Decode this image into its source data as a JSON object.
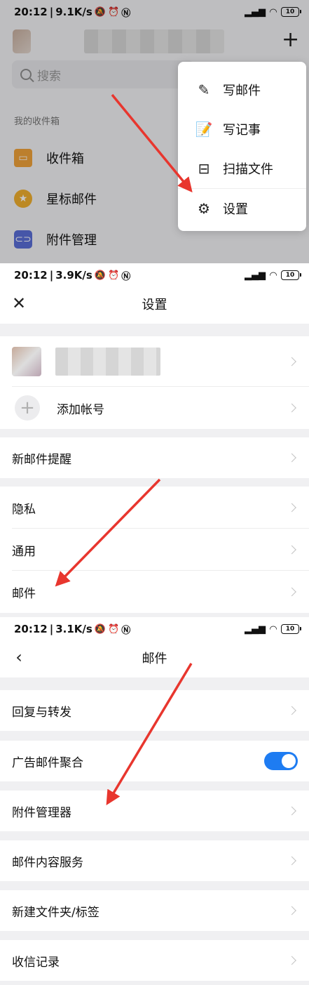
{
  "panel1": {
    "status": {
      "time": "20:12",
      "speed": "9.1K/s",
      "battery": "10"
    },
    "search_placeholder": "搜索",
    "section_label": "我的收件箱",
    "mailboxes": [
      {
        "label": "收件箱",
        "icon": "inbox-icon"
      },
      {
        "label": "星标邮件",
        "icon": "star-icon"
      },
      {
        "label": "附件管理",
        "icon": "attachment-icon"
      }
    ],
    "menu": [
      {
        "label": "写邮件",
        "icon": "compose-icon"
      },
      {
        "label": "写记事",
        "icon": "note-icon"
      },
      {
        "label": "扫描文件",
        "icon": "scan-icon"
      },
      {
        "label": "设置",
        "icon": "gear-icon"
      }
    ]
  },
  "panel2": {
    "status": {
      "time": "20:12",
      "speed": "3.9K/s",
      "battery": "10"
    },
    "title": "设置",
    "add_account": "添加帐号",
    "rows": [
      "新邮件提醒",
      "隐私",
      "通用",
      "邮件"
    ]
  },
  "panel3": {
    "status": {
      "time": "20:12",
      "speed": "3.1K/s",
      "battery": "10"
    },
    "title": "邮件",
    "rows": [
      "回复与转发",
      "广告邮件聚合",
      "附件管理器",
      "邮件内容服务",
      "新建文件夹/标签",
      "收信记录"
    ],
    "ad_merge_enabled": true
  },
  "colors": {
    "accent_blue": "#1e7cf2",
    "arrow_red": "#e8362e"
  }
}
